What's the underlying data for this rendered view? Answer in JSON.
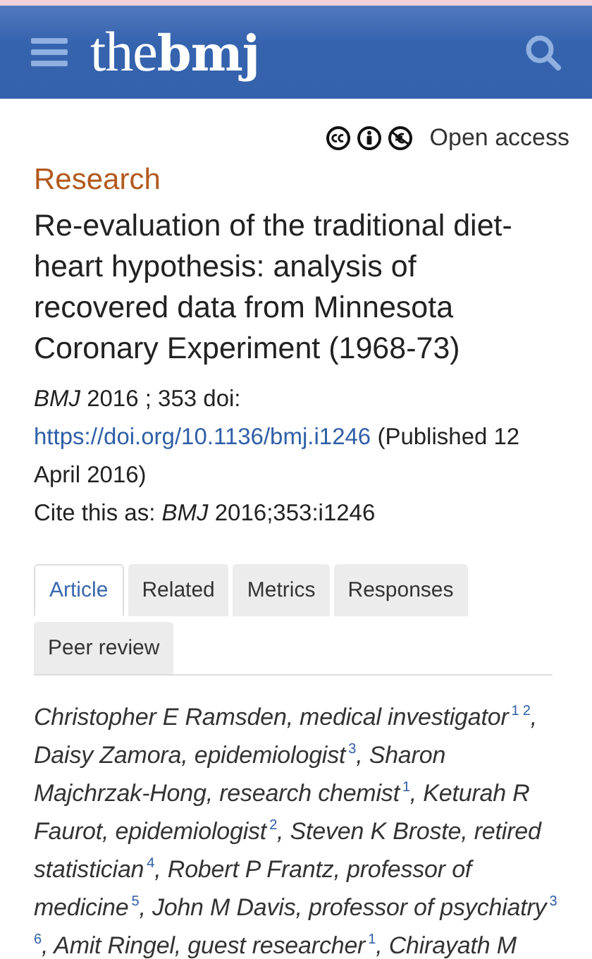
{
  "header": {
    "logo_light": "the",
    "logo_bold": "bmj"
  },
  "license": {
    "label": "Open access"
  },
  "section": "Research",
  "title": "Re-evaluation of the traditional diet-heart hypothesis: analysis of recovered data from Minnesota Coronary Experiment (1968-73)",
  "citation": {
    "journal": "*BMJ*  2016 ; 353  doi:",
    "doi_link": "https://doi.org/10.1136/bmj.i1246",
    "published": "(Published 12 April 2016)",
    "cite_as": "Cite this as: *BMJ*  2016;353:i1246"
  },
  "tabs": [
    {
      "label": "Article",
      "selected": true
    },
    {
      "label": "Related",
      "selected": false
    },
    {
      "label": "Metrics",
      "selected": false
    },
    {
      "label": "Responses",
      "selected": false
    },
    {
      "label": "Peer review",
      "selected": false
    }
  ],
  "authors": "Christopher E Ramsden, medical investigator$^{1 2}$, Daisy Zamora, epidemiologist$^{3}$, Sharon Majchrzak-Hong, research chemist$^{1}$, Keturah R Faurot, epidemiologist$^{2}$, Steven K Broste, retired statistician$^{4}$, Robert P Frantz, professor of medicine$^{5}$, John M Davis, professor of psychiatry$^{3 6}$, Amit Ringel, guest researcher$^{1}$, Chirayath M"
}
